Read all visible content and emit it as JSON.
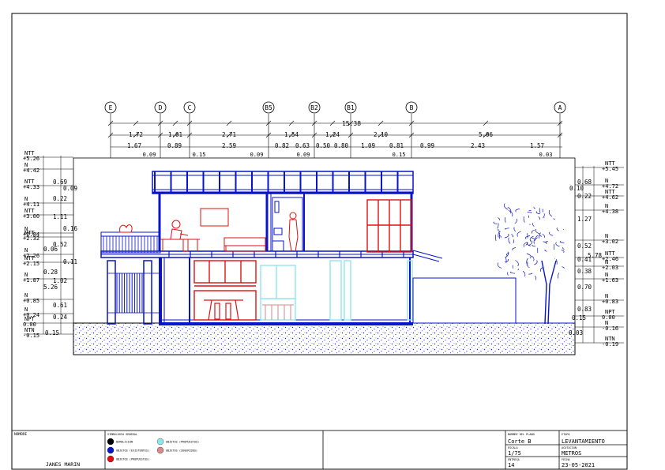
{
  "drawing": {
    "grid_axes": [
      "E",
      "D",
      "C",
      "B5",
      "B2",
      "B1",
      "B",
      "A"
    ],
    "dim_total": "15.38",
    "dim_row1": [
      "1.72",
      "1.01",
      "2.71",
      "1.54",
      "1.24",
      "2.10",
      "5.06"
    ],
    "dim_row2": [
      "1.67",
      "0.89",
      "2.59",
      "0.82",
      "0.63",
      "0.50",
      "0.80",
      "1.09",
      "0.81",
      "0.99",
      "2.43",
      "1.57"
    ],
    "dim_row3": [
      "0.09",
      "0.15",
      "0.09",
      "0.09",
      "0.15",
      "0.03"
    ],
    "left_levels": [
      [
        "NTT",
        "+5.26"
      ],
      [
        "N",
        "+4.42"
      ],
      [
        "NTT",
        "+4.33"
      ],
      [
        "N",
        "+4.11"
      ],
      [
        "NTT",
        "+3.00"
      ],
      [
        "N",
        "+2.84"
      ],
      [
        "NTT",
        "+2.32"
      ],
      [
        "N",
        "+2.26"
      ],
      [
        "NTT",
        "+2.15"
      ],
      [
        "N",
        "+1.87"
      ],
      [
        "N",
        "+0.85"
      ],
      [
        "N",
        "+0.24"
      ],
      [
        "NPT",
        "0.00"
      ],
      [
        "NTN",
        "-0.15"
      ]
    ],
    "left_dims": [
      "0.69",
      "0.09",
      "0.22",
      "1.11",
      "0.16",
      "0.52",
      "0.06",
      "0.11",
      "0.28",
      "1.02",
      "5.26",
      "0.61",
      "0.24",
      "0.15"
    ],
    "right_levels": [
      [
        "NTT",
        "+5.45"
      ],
      [
        "N",
        "+4.72"
      ],
      [
        "NTT",
        "+4.62"
      ],
      [
        "N",
        "+4.38"
      ],
      [
        "N",
        "+3.02"
      ],
      [
        "NTT",
        "+2.46"
      ],
      [
        "N",
        "+2.03"
      ],
      [
        "N",
        "+1.63"
      ],
      [
        "N",
        "+0.83"
      ],
      [
        "NPT",
        "0.00"
      ],
      [
        "N",
        "-0.16"
      ],
      [
        "NTN",
        "-0.19"
      ]
    ],
    "right_dims": [
      "0.68",
      "0.10",
      "0.22",
      "1.27",
      "0.52",
      "5.78",
      "0.41",
      "0.38",
      "0.70",
      "0.83",
      "0.15",
      "0.03"
    ]
  },
  "title_block": {
    "name_label": "NOMBRE",
    "author": "JANES MARIN",
    "legend_title": "SIMBOLOGIA GENERAL",
    "legend": [
      {
        "label": "DEMOLICION",
        "color": "#000000"
      },
      {
        "label": "OBJETOS (EXISTENTES)",
        "color": "#0a14c8"
      },
      {
        "label": "OBJETOS (PROPUESTOS)",
        "color": "#e01010"
      },
      {
        "label": "OBJETOS (PROPUESTOS)",
        "color": "#8fe6f0"
      },
      {
        "label": "OBJETOS (SUGERIDOS)",
        "color": "#d98a8a"
      }
    ],
    "plan_name_label": "NOMBRE DEL PLANO",
    "plan_name": "Corte B",
    "stage_label": "ETAPA",
    "stage": "LEVANTAMIENTO",
    "scale_label": "ESCALA",
    "scale": "1/75",
    "units_label": "ACOTACION",
    "units": "METROS",
    "sheet_label": "ENTREGA",
    "sheet": "14",
    "date_label": "FECHA",
    "date": "23-05-2021"
  }
}
